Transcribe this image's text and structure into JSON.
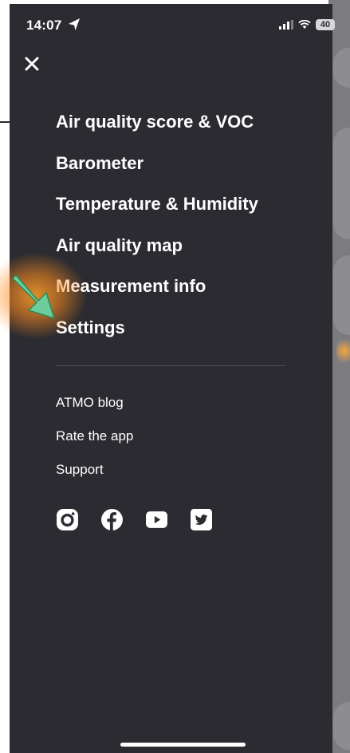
{
  "status_bar": {
    "time": "14:07",
    "battery": "40"
  },
  "primary_menu": [
    "Air quality score & VOC",
    "Barometer",
    "Temperature & Humidity",
    "Air quality map",
    "Measurement info",
    "Settings"
  ],
  "secondary_menu": [
    "ATMO blog",
    "Rate the app",
    "Support"
  ],
  "social_icons": [
    "instagram-icon",
    "facebook-icon",
    "youtube-icon",
    "twitter-icon"
  ],
  "colors": {
    "drawer_bg": "#2b2b31",
    "text": "#ffffff",
    "divider": "#4a4a52",
    "arrow": "#6ccc9a",
    "highlight": "#ffa028"
  }
}
